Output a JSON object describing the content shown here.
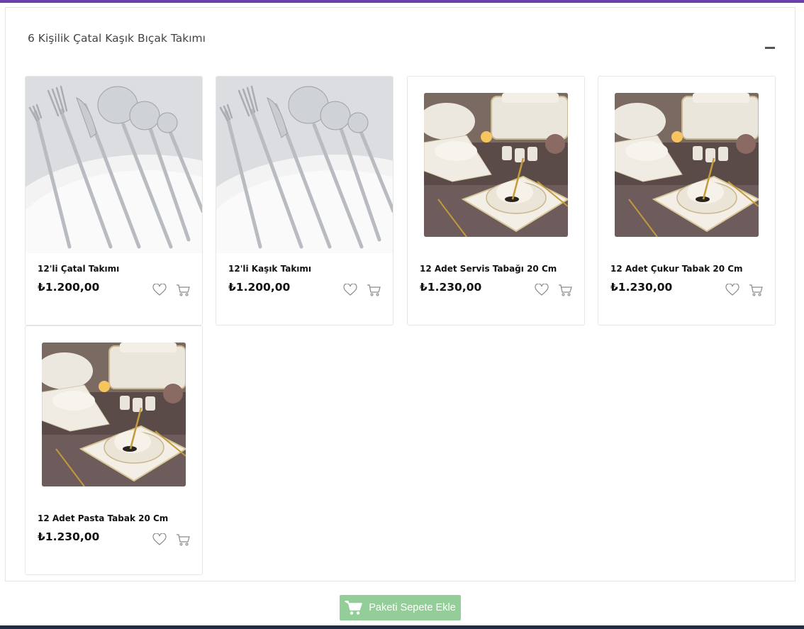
{
  "panel": {
    "title": "6 Kişilik Çatal Kaşık Bıçak Takımı"
  },
  "products": [
    {
      "name": "12'li Çatal Takımı",
      "price": "₺1.200,00",
      "image": "cutlery-set"
    },
    {
      "name": "12'li Kaşık Takımı",
      "price": "₺1.200,00",
      "image": "cutlery-set"
    },
    {
      "name": "12 Adet Servis Tabağı 20 Cm",
      "price": "₺1.230,00",
      "image": "dinnerware-table"
    },
    {
      "name": "12 Adet Çukur Tabak 20 Cm",
      "price": "₺1.230,00",
      "image": "dinnerware-table"
    },
    {
      "name": "12 Adet Pasta Tabak 20 Cm",
      "price": "₺1.230,00",
      "image": "dinnerware-table"
    }
  ],
  "actions": {
    "add_package_label": "Paketi Sepete Ekle"
  },
  "icons": {
    "collapse": "minus-icon",
    "favorite": "heart-icon",
    "cart": "cart-icon"
  },
  "colors": {
    "top_bar": "#6a3fa8",
    "bottom_bar": "#1e2d3f",
    "add_button": "#93ce98",
    "icon_gray": "#8a8a8a"
  }
}
